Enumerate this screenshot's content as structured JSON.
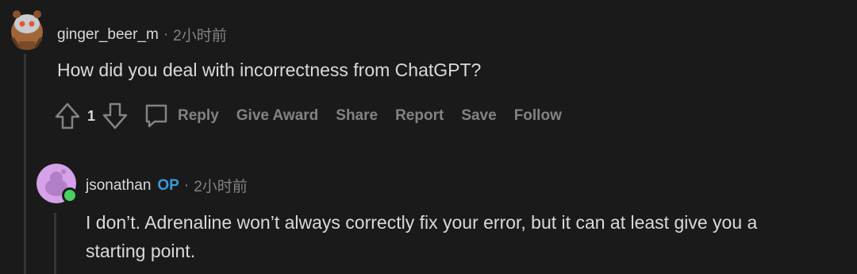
{
  "comment1": {
    "username": "ginger_beer_m",
    "separator": "·",
    "time": "2小时前",
    "text": "How did you deal with incorrectness from ChatGPT?",
    "votes": "1",
    "actions": [
      "Reply",
      "Give Award",
      "Share",
      "Report",
      "Save",
      "Follow"
    ]
  },
  "comment2": {
    "username": "jsonathan",
    "op_badge": "OP",
    "separator": "·",
    "time": "2小时前",
    "text_line1": "I don’t. Adrenaline won’t always correctly fix your error, but it can at least give you a",
    "text_line2": "starting point."
  },
  "colors": {
    "background": "#1a1a1b",
    "text": "#d7dadc",
    "muted": "#818384",
    "op": "#3a9ad9",
    "online": "#46d160"
  }
}
